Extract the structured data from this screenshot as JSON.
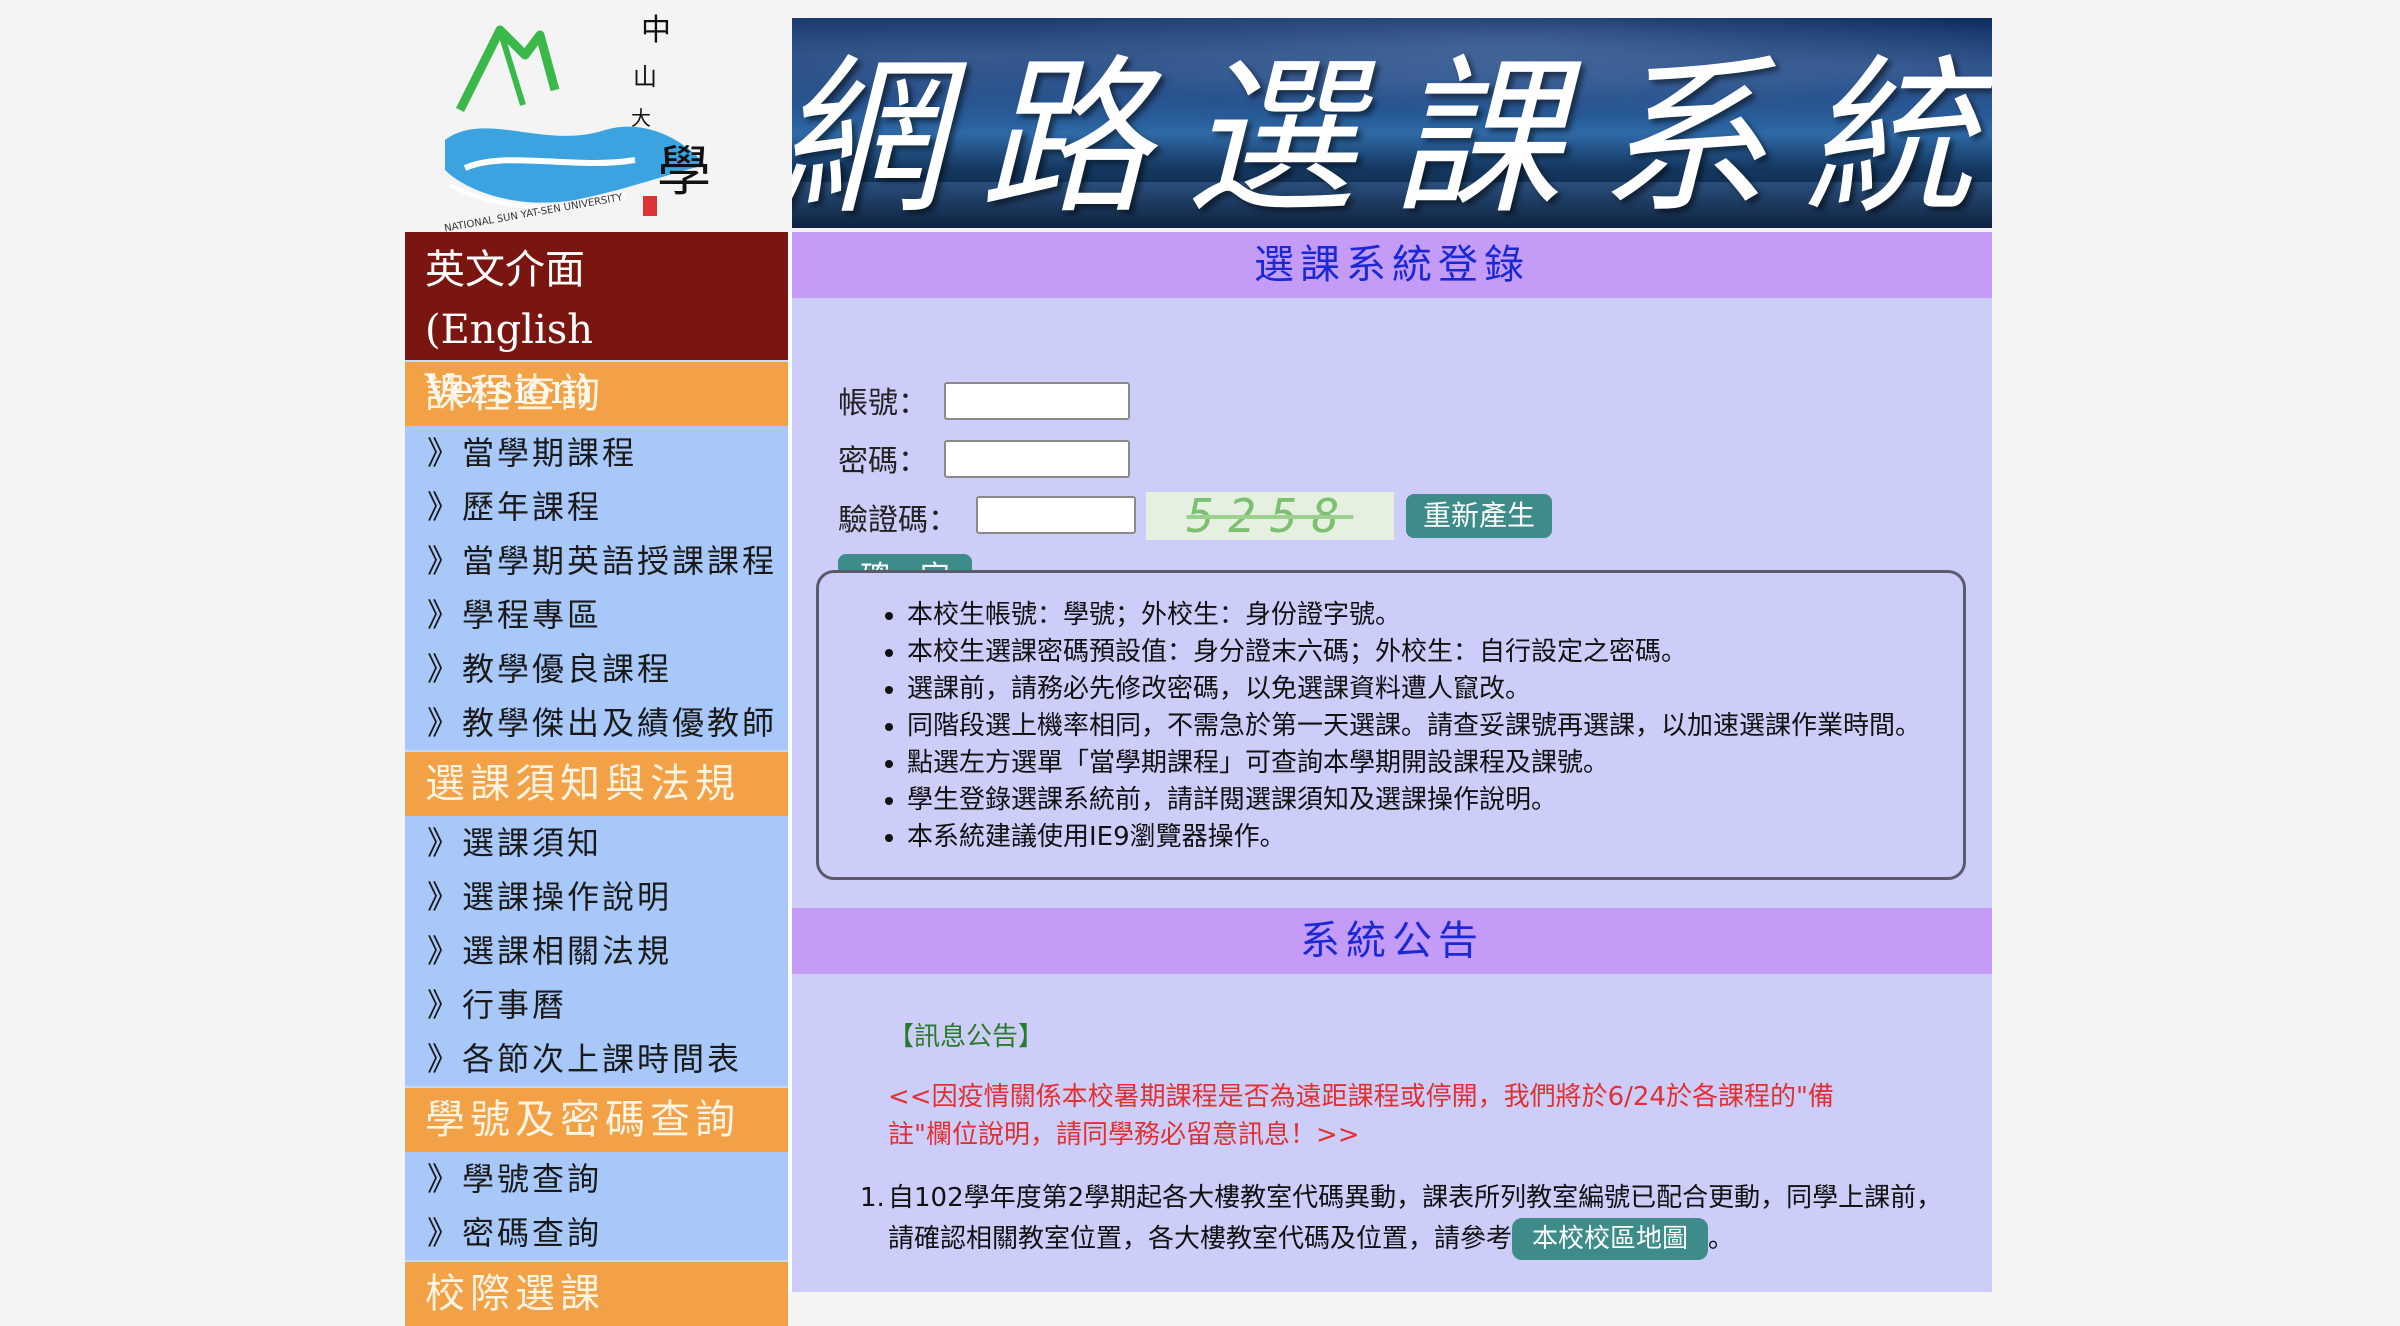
{
  "logo": {
    "text_vertical": "中山大學",
    "text_arc": "NATIONAL SUN YAT-SEN UNIVERSITY"
  },
  "banner": {
    "title": "網路選課系統"
  },
  "sidebar": {
    "english_line1": "英文介面",
    "english_line2": "(English Version)",
    "sections": [
      {
        "title": "課程查詢",
        "items": [
          "》當學期課程",
          "》歷年課程",
          "》當學期英語授課課程",
          "》學程專區",
          "》教學優良課程",
          "》教學傑出及績優教師"
        ]
      },
      {
        "title": "選課須知與法規",
        "items": [
          "》選課須知",
          "》選課操作說明",
          "》選課相關法規",
          "》行事曆",
          "》各節次上課時間表"
        ]
      },
      {
        "title": "學號及密碼查詢",
        "items": [
          "》學號查詢",
          "》密碼查詢"
        ]
      },
      {
        "title": "校際選課",
        "items": []
      }
    ]
  },
  "login": {
    "title": "選課系統登錄",
    "account_label": "帳號：",
    "password_label": "密碼：",
    "captcha_label": "驗證碼：",
    "captcha_code": "5258",
    "regen_button": "重新產生",
    "submit_button": "確　定"
  },
  "notice": [
    "本校生帳號：學號；外校生：身份證字號。",
    "本校生選課密碼預設值：身分證末六碼；外校生：自行設定之密碼。",
    "選課前，請務必先修改密碼，以免選課資料遭人竄改。",
    "同階段選上機率相同，不需急於第一天選課。請查妥課號再選課，以加速選課作業時間。",
    "點選左方選單「當學期課程」可查詢本學期開設課程及課號。",
    "學生登錄選課系統前，請詳閱選課須知及選課操作說明。",
    "本系統建議使用IE9瀏覽器操作。"
  ],
  "announcement": {
    "title": "系統公告",
    "head": "【訊息公告】",
    "red_line1": "<<因疫情關係本校暑期課程是否為遠距課程或停開，我們將於6/24於各課程的\"備",
    "red_line2": "註\"欄位說明，請同學務必留意訊息！>>",
    "item1_num": "1.",
    "item1_text_a": "自102學年度第2學期起各大樓教室代碼異動，課表所列教室編號已配合更動，同學上課前，",
    "item1_text_b": "請確認相關教室位置，各大樓教室代碼及位置，請參考",
    "map_button": "本校校區地圖",
    "item1_end": "。"
  },
  "colors": {
    "english_bg": "#7b1510",
    "section_bg": "#f2a146",
    "sidebar_bg": "#a8c8fa",
    "main_bg": "#cdcdf9",
    "bar_bg": "#c49cf8",
    "bar_text": "#1a28d6",
    "button": "#3d8c8a",
    "red_text": "#e23030",
    "green_text": "#2a7a2a"
  }
}
